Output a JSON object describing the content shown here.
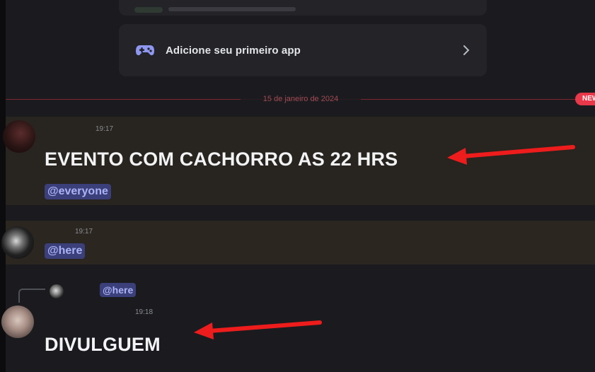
{
  "top_card": {
    "app_label": "Adicione seu primeiro app"
  },
  "divider": {
    "date": "15 de janeiro de 2024",
    "badge": "NEW"
  },
  "messages": [
    {
      "username": "",
      "timestamp": "19:17",
      "content": "EVENTO COM CACHORRO AS 22 HRS",
      "mention": "@everyone"
    },
    {
      "username": "",
      "timestamp": "19:17",
      "mention": "@here"
    },
    {
      "reply_mention": "@here",
      "username": "",
      "timestamp": "19:18",
      "content": "DIVULGUEM"
    }
  ],
  "colors": {
    "background": "#1b1b1f",
    "highlight_row": "#28241f",
    "divider_red": "#7e2630",
    "mention_bg": "#3b3f7a",
    "mention_fg": "#aab3f6",
    "annotation_arrow": "#ee1c1c"
  }
}
